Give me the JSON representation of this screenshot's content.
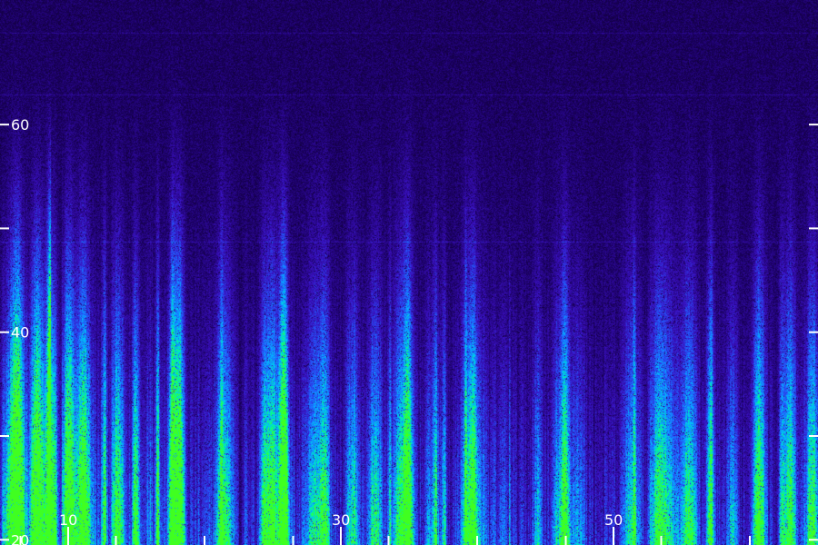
{
  "chart_data": {
    "type": "heatmap",
    "title": "",
    "xlabel": "",
    "ylabel": "",
    "xlim": [
      5,
      65
    ],
    "ylim": [
      19.5,
      72
    ],
    "x_ticks": [
      {
        "value": 10,
        "label": "10"
      },
      {
        "value": 30,
        "label": "30"
      },
      {
        "value": 50,
        "label": "50"
      }
    ],
    "x_minor_ticks": [
      6.5,
      13.5,
      20,
      26.5,
      33.5,
      40,
      46.5,
      53.5,
      60
    ],
    "y_ticks": [
      {
        "value": 20,
        "label": "20"
      },
      {
        "value": 30,
        "label": ""
      },
      {
        "value": 40,
        "label": "40"
      },
      {
        "value": 50,
        "label": ""
      },
      {
        "value": 60,
        "label": "60"
      }
    ],
    "colormap": [
      "#0b0020",
      "#1a0060",
      "#3a10c0",
      "#2060ff",
      "#00c0ff",
      "#00ff90",
      "#40ff20"
    ],
    "grid": false,
    "legend": "none"
  }
}
